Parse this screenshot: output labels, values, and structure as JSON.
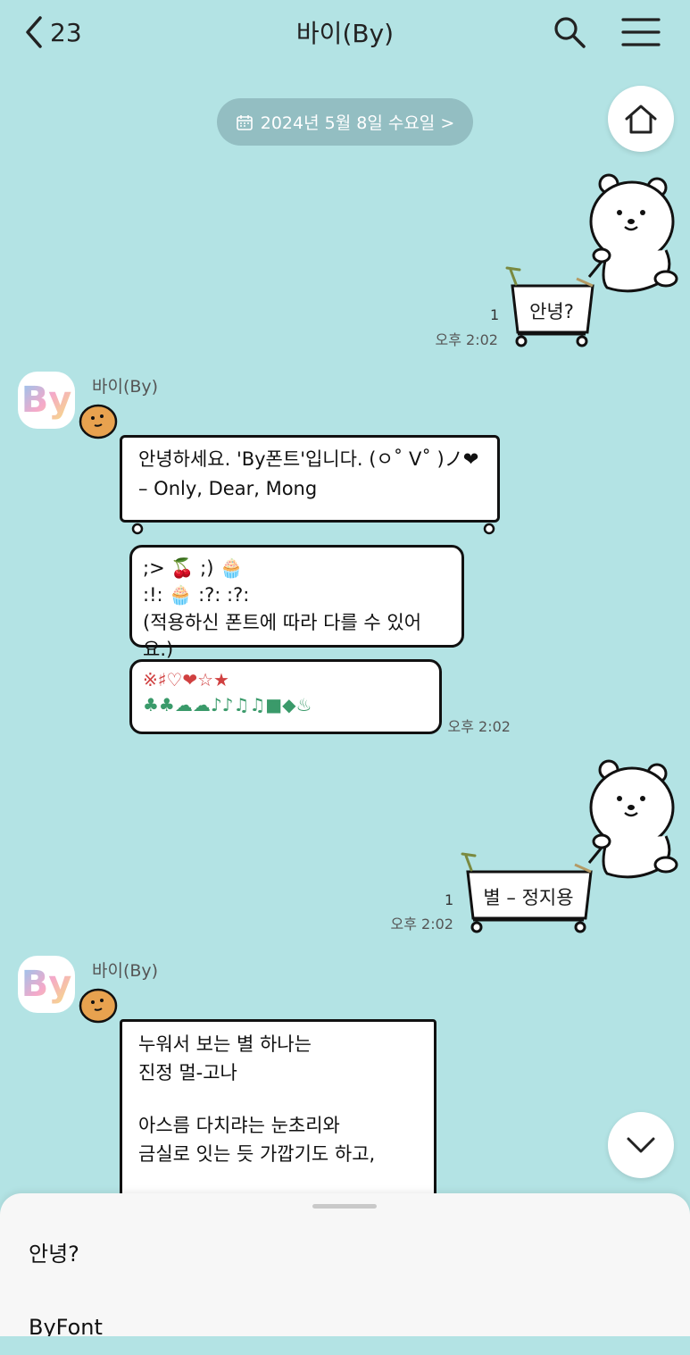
{
  "header": {
    "back_count": "23",
    "title": "바이(By)",
    "icons": [
      "chevron-left-icon",
      "search-icon",
      "menu-icon"
    ]
  },
  "date_divider": {
    "label": "2024년 5월 8일 수요일 >",
    "icon": "calendar-icon"
  },
  "colors": {
    "background": "#b3e3e4",
    "bubble_border": "#111111",
    "bubble_fill": "#ffffff"
  },
  "messages": [
    {
      "type": "sent_sticker",
      "text": "안녕?",
      "unread": "1",
      "time": "오후 2:02"
    },
    {
      "type": "received",
      "sender": "바이(By)",
      "avatar_text": "By",
      "line1": "안녕하세요. 'By폰트'입니다. (ㅇ˚ V˚ )ノ❤",
      "line2": "– Only, Dear, Mong",
      "emoji_box1": [
        ";> 🍒   ;) 🧁",
        ":!: 🧁   :?: :?:",
        "(적용하신 폰트에 따라 다를 수 있어요.)"
      ],
      "emoji_box2_row1": "※♯♡❤☆★",
      "emoji_box2_row2": "♣♣☁☁♪♪♫♫■◆♨",
      "time": "오후 2:02"
    },
    {
      "type": "sent_sticker",
      "text": "별 – 정지용",
      "unread": "1",
      "time": "오후 2:02"
    },
    {
      "type": "received",
      "sender": "바이(By)",
      "avatar_text": "By",
      "lines": [
        "누워서 보는 별 하나는",
        "진정 멀-고나",
        "",
        "아스름 다치랴는 눈초리와",
        "금실로 잇는 듯 가깝기도 하고,"
      ]
    }
  ],
  "bottom_sheet": {
    "suggestions": [
      "안녕?",
      "ByFont"
    ]
  },
  "buttons": {
    "home": "home-icon",
    "scroll_down": "chevron-down-icon"
  }
}
